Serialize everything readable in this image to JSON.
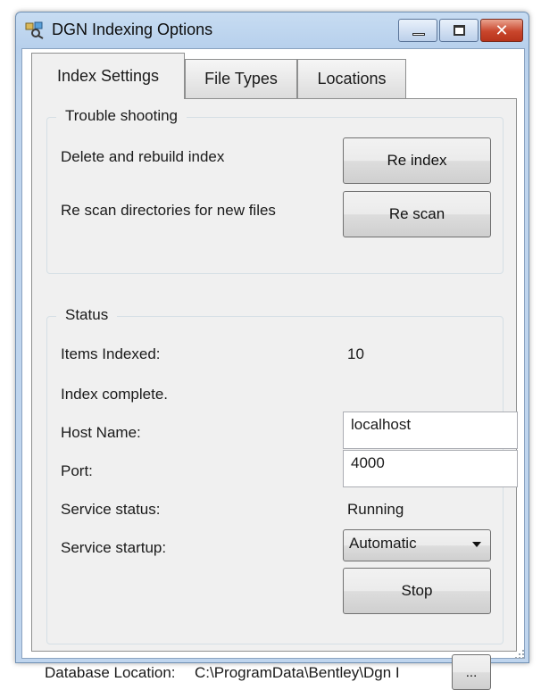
{
  "window": {
    "title": "DGN Indexing Options",
    "close_glyph": "✕"
  },
  "tabs": [
    {
      "label": "Index Settings",
      "active": true
    },
    {
      "label": "File Types",
      "active": false
    },
    {
      "label": "Locations",
      "active": false
    }
  ],
  "troubleshooting": {
    "legend": "Trouble shooting",
    "delete_label": "Delete and rebuild index",
    "reindex_button": "Re index",
    "rescan_label": "Re scan directories for new files",
    "rescan_button": "Re scan"
  },
  "status": {
    "legend": "Status",
    "items_indexed_label": "Items Indexed:",
    "items_indexed_value": "10",
    "index_state": "Index complete.",
    "host_name_label": "Host Name:",
    "host_name_value": "localhost",
    "port_label": "Port:",
    "port_value": "4000",
    "service_status_label": "Service status:",
    "service_status_value": "Running",
    "service_startup_label": "Service startup:",
    "service_startup_value": "Automatic",
    "stop_button": "Stop"
  },
  "database": {
    "label": "Database Location:",
    "path": "C:\\ProgramData\\Bentley\\Dgn I",
    "browse_button": "..."
  },
  "icons": {
    "app": "indexing-app-icon",
    "minimize": "minimize-icon",
    "maximize": "maximize-icon",
    "close": "close-icon",
    "dropdown": "chevron-down-icon",
    "resize": "resize-grip-icon"
  },
  "colors": {
    "titlebar": "#bfd5ee",
    "close_button": "#c9462c",
    "panel": "#f0f0f0"
  }
}
